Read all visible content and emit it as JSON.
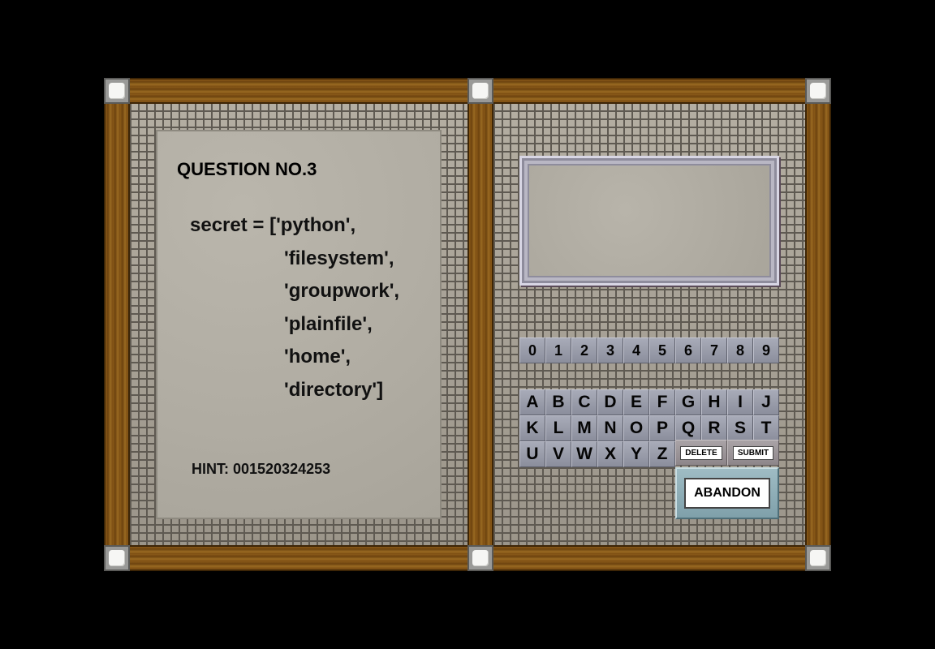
{
  "question": {
    "title": "QUESTION NO.3",
    "code_lines": [
      "secret = ['python',",
      "'filesystem',",
      "'groupwork',",
      "'plainfile',",
      "'home',",
      "'directory']"
    ],
    "hint": "HINT: 001520324253"
  },
  "answer_display": {
    "value": ""
  },
  "keypad": {
    "digits": [
      "0",
      "1",
      "2",
      "3",
      "4",
      "5",
      "6",
      "7",
      "8",
      "9"
    ],
    "letter_rows": [
      [
        "A",
        "B",
        "C",
        "D",
        "E",
        "F",
        "G",
        "H",
        "I",
        "J"
      ],
      [
        "K",
        "L",
        "M",
        "N",
        "O",
        "P",
        "Q",
        "R",
        "S",
        "T"
      ],
      [
        "U",
        "V",
        "W",
        "X",
        "Y",
        "Z"
      ]
    ],
    "delete_label": "DELETE",
    "submit_label": "SUBMIT"
  },
  "abandon_label": "ABANDON"
}
